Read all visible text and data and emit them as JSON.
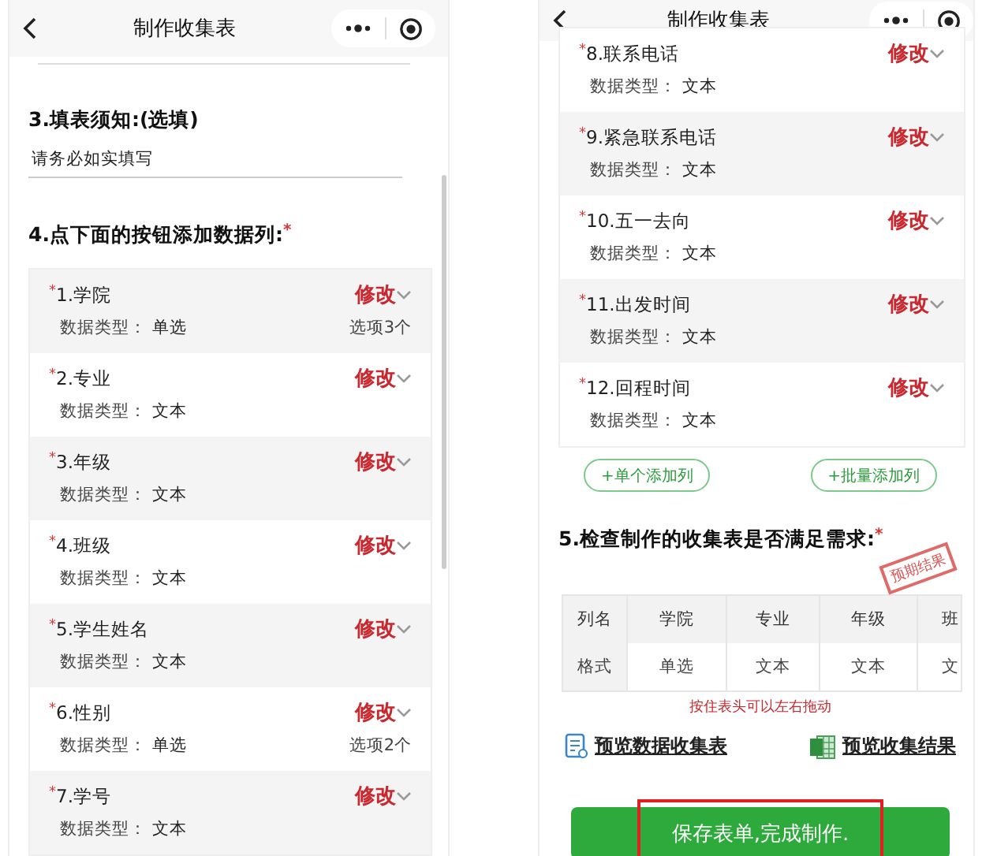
{
  "screens": [
    {
      "title": "制作收集表",
      "sections": [
        {
          "kind": "notice",
          "heading": "3.填表须知:(选填)",
          "value": "请务必如实填写"
        },
        {
          "kind": "columns",
          "heading": "4.点下面的按钮添加数据列:",
          "heading_mark": "*",
          "items": [
            {
              "mark": "*",
              "name": "1.学院",
              "type_label": "数据类型：",
              "type": "单选",
              "options": "选项3个",
              "edit": "修改"
            },
            {
              "mark": "*",
              "name": "2.专业",
              "type_label": "数据类型：",
              "type": "文本",
              "edit": "修改"
            },
            {
              "mark": "*",
              "name": "3.年级",
              "type_label": "数据类型：",
              "type": "文本",
              "edit": "修改"
            },
            {
              "mark": "*",
              "name": "4.班级",
              "type_label": "数据类型：",
              "type": "文本",
              "edit": "修改"
            },
            {
              "mark": "*",
              "name": "5.学生姓名",
              "type_label": "数据类型：",
              "type": "文本",
              "edit": "修改"
            },
            {
              "mark": "*",
              "name": "6.性别",
              "type_label": "数据类型：",
              "type": "单选",
              "options": "选项2个",
              "edit": "修改"
            },
            {
              "mark": "*",
              "name": "7.学号",
              "type_label": "数据类型：",
              "type": "文本",
              "edit": "修改"
            }
          ]
        }
      ]
    },
    {
      "title": "制作收集表",
      "sections": [
        {
          "kind": "columns",
          "items": [
            {
              "mark": "*",
              "name": "8.联系电话",
              "type_label": "数据类型：",
              "type": "文本",
              "edit": "修改"
            },
            {
              "mark": "*",
              "name": "9.紧急联系电话",
              "type_label": "数据类型：",
              "type": "文本",
              "edit": "修改"
            },
            {
              "mark": "*",
              "name": "10.五一去向",
              "type_label": "数据类型：",
              "type": "文本",
              "edit": "修改"
            },
            {
              "mark": "*",
              "name": "11.出发时间",
              "type_label": "数据类型：",
              "type": "文本",
              "edit": "修改"
            },
            {
              "mark": "*",
              "name": "12.回程时间",
              "type_label": "数据类型：",
              "type": "文本",
              "edit": "修改"
            }
          ],
          "buttons": [
            "+单个添加列",
            "+批量添加列"
          ]
        },
        {
          "kind": "preview",
          "heading": "5.检查制作的收集表是否满足需求:",
          "heading_mark": "*",
          "stamp": "预期结果",
          "table": {
            "columns": [
              "列名",
              "学院",
              "专业",
              "年级",
              "班"
            ],
            "rows": [
              [
                "格式",
                "单选",
                "文本",
                "文本",
                "文"
              ]
            ]
          },
          "hint": "按住表头可以左右拖动",
          "links": [
            {
              "kind": "form",
              "label": "预览数据收集表"
            },
            {
              "kind": "sheet",
              "label": "预览收集结果"
            }
          ],
          "save_button": {
            "label": "保存表单,完成制作.",
            "highlighted": true
          }
        }
      ]
    }
  ]
}
